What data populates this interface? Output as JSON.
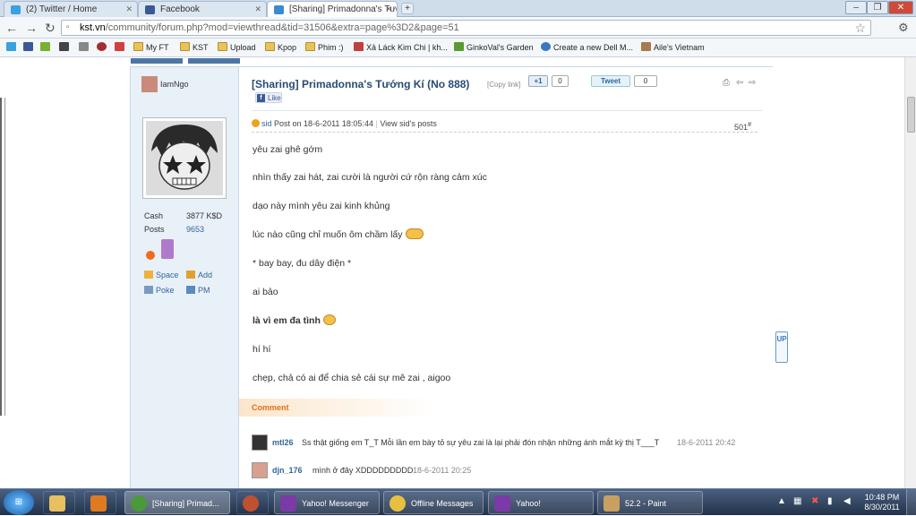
{
  "browser": {
    "tabs": [
      {
        "label": "(2) Twitter / Home",
        "favicon": "twitter-icon"
      },
      {
        "label": "Facebook",
        "favicon": "facebook-icon"
      },
      {
        "label": "[Sharing] Primadonna's Tươ",
        "favicon": "forum-icon",
        "active": true
      }
    ],
    "new_tab": "+",
    "url_host": "kst.vn",
    "url_path": "/community/forum.php?mod=viewthread&tid=31506&extra=page%3D2&page=51",
    "bookmarks": [
      "My FT",
      "KST",
      "Upload",
      "Kpop",
      "Phim :)",
      "Xả Láck Kim Chi | kh...",
      "GinkoVal's Garden",
      "Create a new Dell M...",
      "Aile's Vietnam"
    ]
  },
  "post": {
    "author_small": "IamNgo",
    "title": "[Sharing] Primadonna's Tướng Kí (No 888)",
    "copy_link": "[Copy link]",
    "plus_one": "+1",
    "plus_one_count": "0",
    "tweet": "Tweet",
    "tweet_count": "0",
    "like": "Like",
    "meta_author": "sid",
    "meta_posted": "Post on 18-6-2011 18:05:44",
    "meta_view": "View sid's posts",
    "post_number": "501",
    "post_number_suffix": "#",
    "lines": [
      "yêu zai ghê gớm",
      "nhìn thấy zai hát, zai cười là người cứ rộn ràng cảm xúc",
      "dạo này mình yêu zai kinh khủng",
      "lúc nào cũng chỉ muốn ôm chầm lấy",
      "* bay bay, đu dây điện *",
      "ai bảo",
      "là vì em đa tình",
      "hí hí",
      "chẹp, chả có ai để chia sẻ cái sự mê zai , aigoo"
    ],
    "comment_label": "Comment",
    "comments": [
      {
        "name": "mtl26",
        "text": "Ss thật giống em T_T Mỗi lần em bày tỏ sự yêu zai là lại phải đón nhận những ánh mắt kỳ thị T___T",
        "time": "18-6-2011 20:42"
      },
      {
        "name": "djn_176",
        "text": "mình ở đây XDDDDDDDDD",
        "time": "18-6-2011 20:25"
      }
    ],
    "up_label": "UP"
  },
  "profile": {
    "cash_label": "Cash",
    "cash_value": "3877 K$D",
    "posts_label": "Posts",
    "posts_value": "9653",
    "links": [
      "Space",
      "Add",
      "Poke",
      "PM"
    ]
  },
  "taskbar": {
    "start": "Start",
    "buttons": [
      "[Sharing] Primad...",
      "Yahoo! Messenger",
      "Offline Messages",
      "Yahoo!",
      "52.2 - Paint"
    ],
    "time": "10:48 PM",
    "date": "8/30/2011"
  }
}
